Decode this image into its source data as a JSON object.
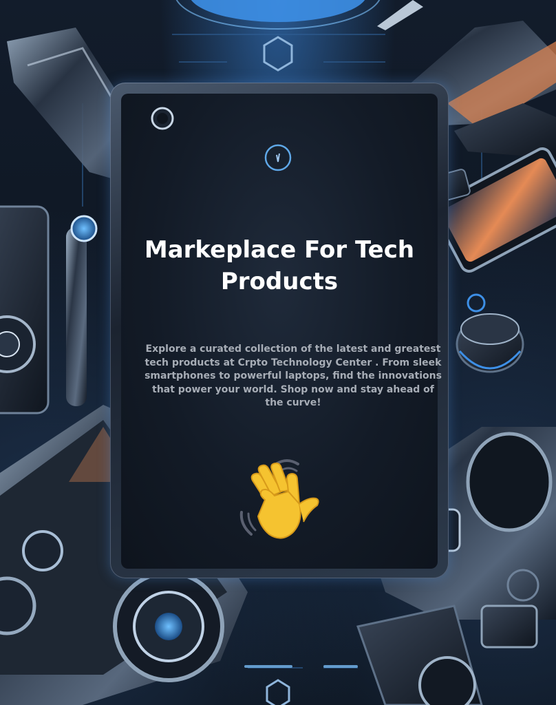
{
  "hero": {
    "title": "Markeplace For Tech Products",
    "description": "Explore a curated collection of the latest and greatest tech products at Crpto Technology Center  . From sleek smartphones to powerful laptops, find the innovations that power your world. Shop now and stay ahead of the curve!",
    "emoji_icon": "waving-hand-icon"
  },
  "colors": {
    "background": "#0d1420",
    "accent": "#3d8fe6",
    "title": "#ffffff",
    "description": "#a7adb6",
    "hand": "#f5c330"
  }
}
